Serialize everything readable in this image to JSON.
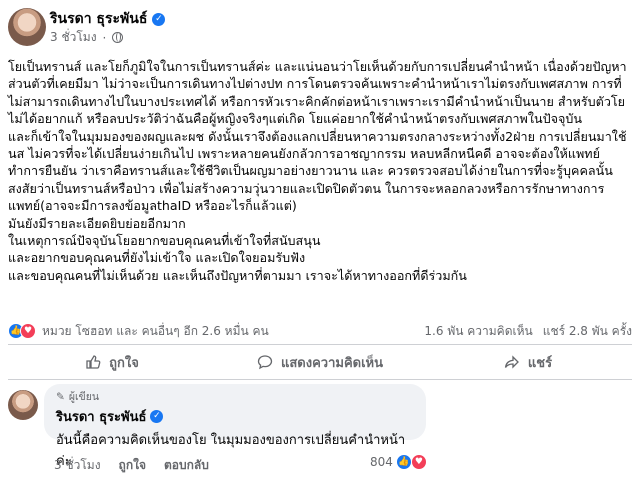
{
  "post": {
    "author": "รินรดา ธุระพันธ์",
    "time": "3 ชั่วโมง",
    "body": [
      "โยเป็นทรานส์ และโยก็ภูมิใจในการเป็นทรานส์ค่ะ และแน่นอนว่าโยเห็นด้วยกับการเปลี่ยนคำนำหน้า เนื่องด้วยปัญหาส่วนตัวที่เคยมีมา ไม่ว่าจะเป็นการเดินทางไปต่างปท การโดนตรวจค้นเพราะคำนำหน้าเราไม่ตรงกับเพศสภาพ การที่ไม่สามารถเดินทางไปในบางประเทศได้ หรือการหัวเราะคิกคักต่อหน้าเราเพราะเรามีคำนำหน้าเป็นนาย สำหรับตัวโย ไม่ได้อยากแก้ หรือลบประวัติว่าฉันคือผู้หญิงจริงๆแต่เกิด โยแค่อยากใช้คำนำหน้าตรงกับเพศสภาพในปัจจุบัน",
      "และก็เข้าใจในมุมมองของผญและผช ดังนั้นเราจึงต้องแลกเปลี่ยนหาความตรงกลางระหว่างทั้ง2ฝ่าย การเปลี่ยนมาใช้ นส ไม่ควรที่จะได้เปลี่ยนง่ายเกินไป เพราะหลายคนยังกลัวการอาชญากรรม หลบหลีกหนีคดี อาจจะต้องให้แพทย์ทำการยืนยัน ว่าเราคือทรานส์และใช้ชีวิตเป็นผญมาอย่างยาวนาน และ ควรตรวจสอบได้ง่ายในการที่จะรู้บุคคลนั้นสงสัยว่าเป็นทรานส์หรือป่าว เพื่อไม่สร้างความวุ่นวายและเปิดปิดตัวตน ในการจะหลอกลวงหรือการรักษาทางการแพทย์(อาจจะมีการลงข้อมูลthaID หรืออะไรก็แล้วแต่)",
      "มันยังมีรายละเอียดยิบย่อยอีกมาก",
      "ในเหตุการณ์ปัจจุบันโยอยากขอบคุณคนที่เข้าใจที่สนับสนุน",
      "และอยากขอบคุณคนที่ยังไม่เข้าใจ และเปิดใจยอมรับฟัง",
      "และขอบคุณคนที่ไม่เห็นด้วย และเห็นถึงปัญหาที่ตามมา เราจะได้หาทางออกที่ดีร่วมกัน"
    ],
    "reactions_text": "หมวย โซฮอท และ คนอื่นๆ อีก 2.6 หมื่น คน",
    "comments_count": "1.6 พัน ความคิดเห็น",
    "shares_count": "แชร์ 2.8 พัน ครั้ง"
  },
  "actions": {
    "like": "ถูกใจ",
    "comment": "แสดงความคิดเห็น",
    "share": "แชร์"
  },
  "comment": {
    "badge": "ผู้เขียน",
    "author": "รินรดา ธุระพันธ์",
    "text": "อันนี้คือความคิดเห็นของโย ในมุมมองของการเปลี่ยนคำนำหน้าค่ะ",
    "time": "3 ชั่วโมง",
    "like": "ถูกใจ",
    "reply": "ตอบกลับ",
    "reaction_count": "804"
  },
  "colors": {
    "accent": "#1877f2",
    "love": "#f33e58",
    "muted": "#65676b"
  },
  "icons": [
    "verified-icon",
    "globe-icon",
    "like-icon",
    "love-icon",
    "comment-icon",
    "share-icon",
    "author-badge-icon"
  ]
}
